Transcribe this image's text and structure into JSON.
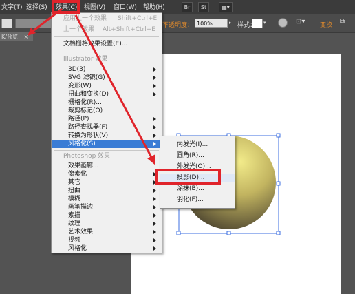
{
  "menubar": {
    "items": [
      "文字(T)",
      "选择(S)",
      "效果(C)",
      "视图(V)",
      "窗口(W)",
      "帮助(H)"
    ],
    "btn_br": "Br",
    "btn_st": "St"
  },
  "controlbar": {
    "opacity_label": "不透明度：",
    "opacity_value": "100%",
    "style_label": "样式：",
    "transform_label": "变换"
  },
  "document_tab": "K/预览",
  "effect_menu": {
    "apply_last": {
      "label": "应用上一个效果",
      "shortcut": "Shift+Ctrl+E"
    },
    "last_effect": {
      "label": "上一个效果",
      "shortcut": "Alt+Shift+Ctrl+E"
    },
    "raster_settings": "文档栅格效果设置(E)...",
    "illustrator_header": "Illustrator 效果",
    "illustrator_items": [
      "3D(3)",
      "SVG 滤镜(G)",
      "变形(W)",
      "扭曲和变换(D)",
      "栅格化(R)...",
      "裁剪标记(O)",
      "路径(P)",
      "路径查找器(F)",
      "转换为形状(V)",
      "风格化(S)"
    ],
    "photoshop_header": "Photoshop 效果",
    "photoshop_items": [
      "效果画廊...",
      "像素化",
      "其它",
      "扭曲",
      "模糊",
      "画笔描边",
      "素描",
      "纹理",
      "艺术效果",
      "视频",
      "风格化"
    ]
  },
  "stylize_submenu": {
    "items": [
      "内发光(I)...",
      "圆角(R)...",
      "外发光(O)...",
      "投影(D)...",
      "涂抹(B)...",
      "羽化(F)..."
    ],
    "highlighted": "投影(D)..."
  },
  "colors": {
    "accent_orange": "#e08a2c",
    "highlight_blue": "#3a7cd5",
    "annotation_red": "#e0242b"
  }
}
